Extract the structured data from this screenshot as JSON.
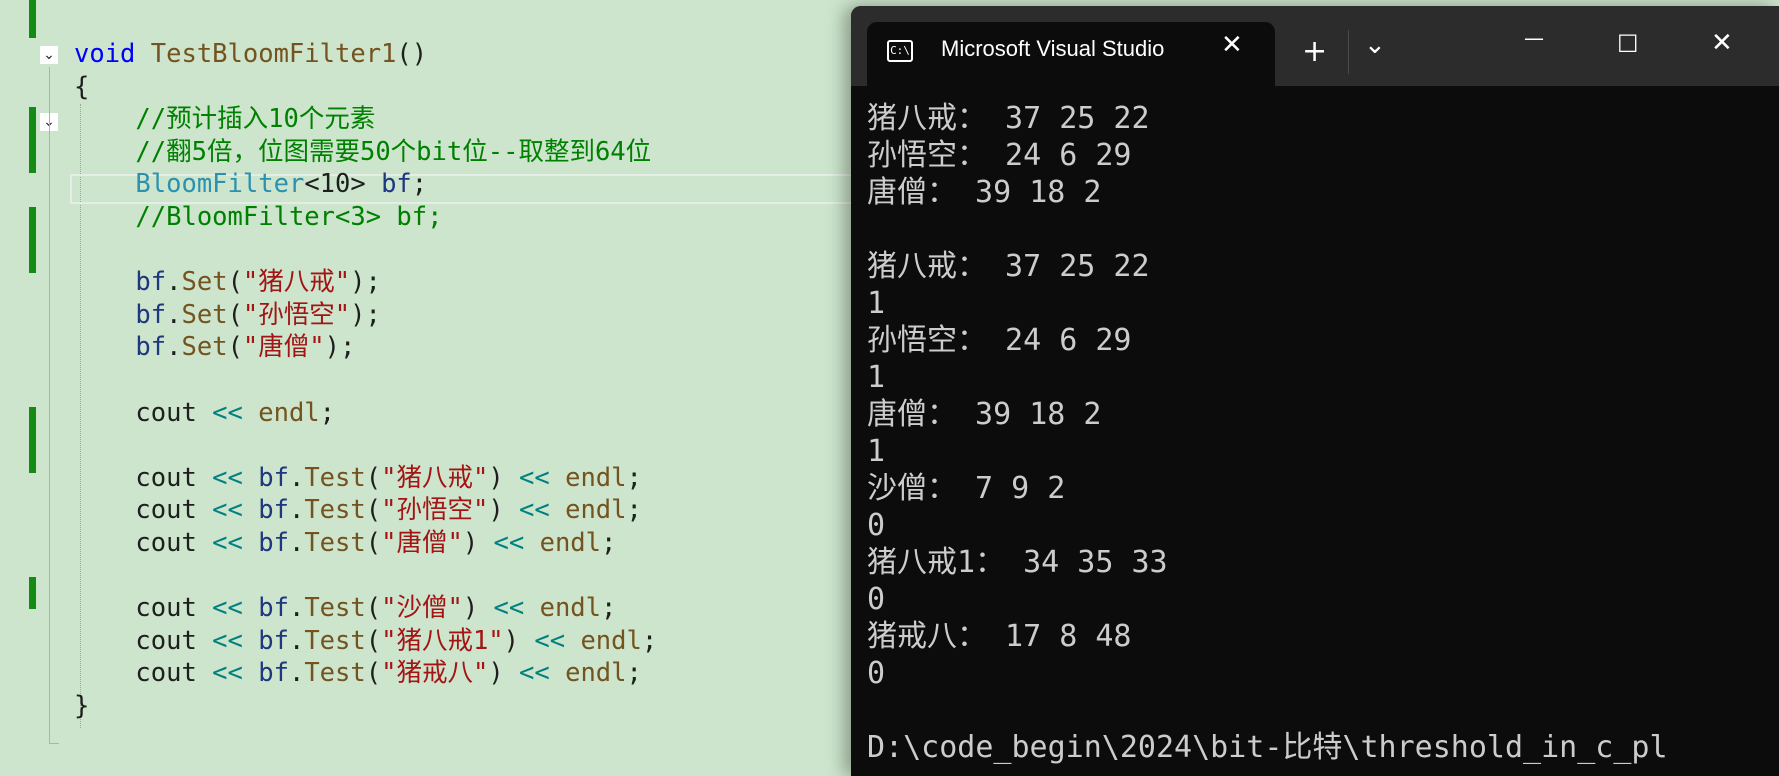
{
  "editor": {
    "lines": [
      [
        [
          "kw",
          "void "
        ],
        [
          "fn",
          "TestBloomFilter1"
        ],
        [
          "",
          "()"
        ]
      ],
      [
        [
          "",
          "{"
        ]
      ],
      [
        [
          "",
          "    "
        ],
        [
          "cm",
          "//预计插入10个元素"
        ]
      ],
      [
        [
          "",
          "    "
        ],
        [
          "cm",
          "//翻5倍，位图需要50个bit位--取整到64位"
        ]
      ],
      [
        [
          "",
          "    "
        ],
        [
          "ty",
          "BloomFilter"
        ],
        [
          "",
          "<10> "
        ],
        [
          "var",
          "bf"
        ],
        [
          "",
          ";"
        ]
      ],
      [
        [
          "",
          "    "
        ],
        [
          "cm",
          "//BloomFilter<3> bf;"
        ]
      ],
      [],
      [
        [
          "",
          "    "
        ],
        [
          "var",
          "bf"
        ],
        [
          "",
          "."
        ],
        [
          "mem",
          "Set"
        ],
        [
          "",
          "("
        ],
        [
          "str",
          "\"猪八戒\""
        ],
        [
          "",
          ");"
        ]
      ],
      [
        [
          "",
          "    "
        ],
        [
          "var",
          "bf"
        ],
        [
          "",
          "."
        ],
        [
          "mem",
          "Set"
        ],
        [
          "",
          "("
        ],
        [
          "str",
          "\"孙悟空\""
        ],
        [
          "",
          ");"
        ]
      ],
      [
        [
          "",
          "    "
        ],
        [
          "var",
          "bf"
        ],
        [
          "",
          "."
        ],
        [
          "mem",
          "Set"
        ],
        [
          "",
          "("
        ],
        [
          "str",
          "\"唐僧\""
        ],
        [
          "",
          ");"
        ]
      ],
      [],
      [
        [
          "",
          "    cout "
        ],
        [
          "op",
          "<<"
        ],
        [
          "fn",
          " endl"
        ],
        [
          "",
          ";"
        ]
      ],
      [],
      [
        [
          "",
          "    cout "
        ],
        [
          "op",
          "<<"
        ],
        [
          "var",
          " bf"
        ],
        [
          "",
          "."
        ],
        [
          "mem",
          "Test"
        ],
        [
          "",
          "("
        ],
        [
          "str",
          "\"猪八戒\""
        ],
        [
          "",
          ") "
        ],
        [
          "op",
          "<<"
        ],
        [
          "fn",
          " endl"
        ],
        [
          "",
          ";"
        ]
      ],
      [
        [
          "",
          "    cout "
        ],
        [
          "op",
          "<<"
        ],
        [
          "var",
          " bf"
        ],
        [
          "",
          "."
        ],
        [
          "mem",
          "Test"
        ],
        [
          "",
          "("
        ],
        [
          "str",
          "\"孙悟空\""
        ],
        [
          "",
          ") "
        ],
        [
          "op",
          "<<"
        ],
        [
          "fn",
          " endl"
        ],
        [
          "",
          ";"
        ]
      ],
      [
        [
          "",
          "    cout "
        ],
        [
          "op",
          "<<"
        ],
        [
          "var",
          " bf"
        ],
        [
          "",
          "."
        ],
        [
          "mem",
          "Test"
        ],
        [
          "",
          "("
        ],
        [
          "str",
          "\"唐僧\""
        ],
        [
          "",
          ") "
        ],
        [
          "op",
          "<<"
        ],
        [
          "fn",
          " endl"
        ],
        [
          "",
          ";"
        ]
      ],
      [],
      [
        [
          "",
          "    cout "
        ],
        [
          "op",
          "<<"
        ],
        [
          "var",
          " bf"
        ],
        [
          "",
          "."
        ],
        [
          "mem",
          "Test"
        ],
        [
          "",
          "("
        ],
        [
          "str",
          "\"沙僧\""
        ],
        [
          "",
          ") "
        ],
        [
          "op",
          "<<"
        ],
        [
          "fn",
          " endl"
        ],
        [
          "",
          ";"
        ]
      ],
      [
        [
          "",
          "    cout "
        ],
        [
          "op",
          "<<"
        ],
        [
          "var",
          " bf"
        ],
        [
          "",
          "."
        ],
        [
          "mem",
          "Test"
        ],
        [
          "",
          "("
        ],
        [
          "str",
          "\"猪八戒1\""
        ],
        [
          "",
          ") "
        ],
        [
          "op",
          "<<"
        ],
        [
          "fn",
          " endl"
        ],
        [
          "",
          ";"
        ]
      ],
      [
        [
          "",
          "    cout "
        ],
        [
          "op",
          "<<"
        ],
        [
          "var",
          " bf"
        ],
        [
          "",
          "."
        ],
        [
          "mem",
          "Test"
        ],
        [
          "",
          "("
        ],
        [
          "str",
          "\"猪戒八\""
        ],
        [
          "",
          ") "
        ],
        [
          "op",
          "<<"
        ],
        [
          "fn",
          " endl"
        ],
        [
          "",
          ";"
        ]
      ],
      [
        [
          "",
          "}"
        ]
      ]
    ],
    "fold_glyph": "⌄"
  },
  "colors": {
    "editor_bg": "#cce5cc",
    "change_bar": "#158b15",
    "terminal_bg": "#0c0c0c",
    "terminal_titlebar": "#2c2c2c",
    "terminal_text": "#cccccc"
  },
  "terminal": {
    "tab_title": "Microsoft Visual Studio",
    "tab_icon_label": "C:\\",
    "tab_icon": "console-icon",
    "close_tab": "✕",
    "new_tab": "+",
    "dropdown": "⌄",
    "minimize": "—",
    "maximize": "☐",
    "close_window": "✕",
    "output": [
      "猪八戒： 37 25 22",
      "孙悟空： 24 6 29",
      "唐僧： 39 18 2",
      "",
      "猪八戒： 37 25 22",
      "1",
      "孙悟空： 24 6 29",
      "1",
      "唐僧： 39 18 2",
      "1",
      "沙僧： 7 9 2",
      "0",
      "猪八戒1： 34 35 33",
      "0",
      "猪戒八： 17 8 48",
      "0",
      "",
      "D:\\code_begin\\2024\\bit-比特\\threshold_in_c_pl"
    ]
  }
}
